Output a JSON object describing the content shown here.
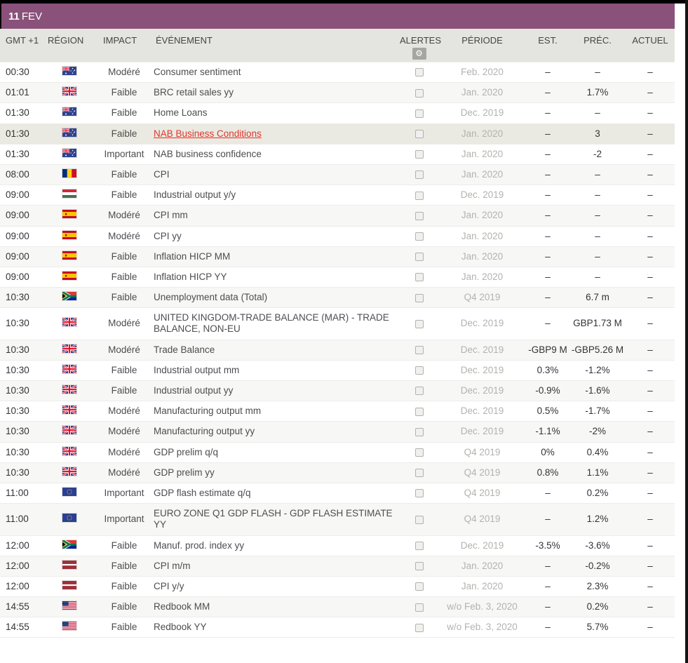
{
  "banner": {
    "day": "11",
    "month": "FEV"
  },
  "icons": {
    "gear_glyph": "⚙"
  },
  "colors": {
    "banner_bg": "#8a527a",
    "header_bg": "#e4e4e0",
    "row_alt_bg": "#f7f7f5",
    "highlight_row_bg": "#eaeae2",
    "link_red": "#e0352b",
    "period_text": "#b2b2b0"
  },
  "table": {
    "columns": [
      "GMT +1",
      "RÉGION",
      "IMPACT",
      "ÉVÉNEMENT",
      "ALERTES",
      "PÉRIODE",
      "EST.",
      "PRÉC.",
      "ACTUEL"
    ],
    "rows": [
      {
        "time": "00:30",
        "region": "AU",
        "impact": "Modéré",
        "event": "Consumer sentiment",
        "period": "Feb. 2020",
        "est": "–",
        "prev": "–",
        "actual": "–"
      },
      {
        "time": "01:01",
        "region": "GB",
        "impact": "Faible",
        "event": "BRC retail sales yy",
        "period": "Jan. 2020",
        "est": "–",
        "prev": "1.7%",
        "actual": "–"
      },
      {
        "time": "01:30",
        "region": "AU",
        "impact": "Faible",
        "event": "Home Loans",
        "period": "Dec. 2019",
        "est": "–",
        "prev": "–",
        "actual": "–"
      },
      {
        "time": "01:30",
        "region": "AU",
        "impact": "Faible",
        "event": "NAB Business Conditions",
        "period": "Jan. 2020",
        "est": "–",
        "prev": "3",
        "actual": "–",
        "link": true,
        "highlight": true
      },
      {
        "time": "01:30",
        "region": "AU",
        "impact": "Important",
        "event": "NAB business confidence",
        "period": "Jan. 2020",
        "est": "–",
        "prev": "-2",
        "actual": "–"
      },
      {
        "time": "08:00",
        "region": "RO",
        "impact": "Faible",
        "event": "CPI",
        "period": "Jan. 2020",
        "est": "–",
        "prev": "–",
        "actual": "–"
      },
      {
        "time": "09:00",
        "region": "HU",
        "impact": "Faible",
        "event": "Industrial output y/y",
        "period": "Dec. 2019",
        "est": "–",
        "prev": "–",
        "actual": "–"
      },
      {
        "time": "09:00",
        "region": "ES",
        "impact": "Modéré",
        "event": "CPI mm",
        "period": "Jan. 2020",
        "est": "–",
        "prev": "–",
        "actual": "–"
      },
      {
        "time": "09:00",
        "region": "ES",
        "impact": "Modéré",
        "event": "CPI yy",
        "period": "Jan. 2020",
        "est": "–",
        "prev": "–",
        "actual": "–"
      },
      {
        "time": "09:00",
        "region": "ES",
        "impact": "Faible",
        "event": "Inflation HICP MM",
        "period": "Jan. 2020",
        "est": "–",
        "prev": "–",
        "actual": "–"
      },
      {
        "time": "09:00",
        "region": "ES",
        "impact": "Faible",
        "event": "Inflation HICP YY",
        "period": "Jan. 2020",
        "est": "–",
        "prev": "–",
        "actual": "–"
      },
      {
        "time": "10:30",
        "region": "ZA",
        "impact": "Faible",
        "event": "Unemployment data (Total)",
        "period": "Q4 2019",
        "est": "–",
        "prev": "6.7 m",
        "actual": "–"
      },
      {
        "time": "10:30",
        "region": "GB",
        "impact": "Modéré",
        "event": "UNITED KINGDOM-TRADE BALANCE (MAR) - TRADE BALANCE, NON-EU",
        "period": "Dec. 2019",
        "est": "–",
        "prev": "GBP1.73 M",
        "actual": "–"
      },
      {
        "time": "10:30",
        "region": "GB",
        "impact": "Modéré",
        "event": "Trade Balance",
        "period": "Dec. 2019",
        "est": "-GBP9 M",
        "prev": "-GBP5.26 M",
        "actual": "–"
      },
      {
        "time": "10:30",
        "region": "GB",
        "impact": "Faible",
        "event": "Industrial output mm",
        "period": "Dec. 2019",
        "est": "0.3%",
        "prev": "-1.2%",
        "actual": "–"
      },
      {
        "time": "10:30",
        "region": "GB",
        "impact": "Faible",
        "event": "Industrial output yy",
        "period": "Dec. 2019",
        "est": "-0.9%",
        "prev": "-1.6%",
        "actual": "–"
      },
      {
        "time": "10:30",
        "region": "GB",
        "impact": "Modéré",
        "event": "Manufacturing output mm",
        "period": "Dec. 2019",
        "est": "0.5%",
        "prev": "-1.7%",
        "actual": "–"
      },
      {
        "time": "10:30",
        "region": "GB",
        "impact": "Modéré",
        "event": "Manufacturing output yy",
        "period": "Dec. 2019",
        "est": "-1.1%",
        "prev": "-2%",
        "actual": "–"
      },
      {
        "time": "10:30",
        "region": "GB",
        "impact": "Modéré",
        "event": "GDP prelim q/q",
        "period": "Q4 2019",
        "est": "0%",
        "prev": "0.4%",
        "actual": "–"
      },
      {
        "time": "10:30",
        "region": "GB",
        "impact": "Modéré",
        "event": "GDP prelim yy",
        "period": "Q4 2019",
        "est": "0.8%",
        "prev": "1.1%",
        "actual": "–"
      },
      {
        "time": "11:00",
        "region": "EU",
        "impact": "Important",
        "event": "GDP flash estimate q/q",
        "period": "Q4 2019",
        "est": "–",
        "prev": "0.2%",
        "actual": "–"
      },
      {
        "time": "11:00",
        "region": "EU",
        "impact": "Important",
        "event": "EURO ZONE Q1 GDP FLASH - GDP FLASH ESTIMATE YY",
        "period": "Q4 2019",
        "est": "–",
        "prev": "1.2%",
        "actual": "–"
      },
      {
        "time": "12:00",
        "region": "ZA",
        "impact": "Faible",
        "event": "Manuf. prod. index yy",
        "period": "Dec. 2019",
        "est": "-3.5%",
        "prev": "-3.6%",
        "actual": "–"
      },
      {
        "time": "12:00",
        "region": "LV",
        "impact": "Faible",
        "event": "CPI m/m",
        "period": "Jan. 2020",
        "est": "–",
        "prev": "-0.2%",
        "actual": "–"
      },
      {
        "time": "12:00",
        "region": "LV",
        "impact": "Faible",
        "event": "CPI y/y",
        "period": "Jan. 2020",
        "est": "–",
        "prev": "2.3%",
        "actual": "–"
      },
      {
        "time": "14:55",
        "region": "US",
        "impact": "Faible",
        "event": "Redbook MM",
        "period": "w/o Feb. 3, 2020",
        "est": "–",
        "prev": "0.2%",
        "actual": "–"
      },
      {
        "time": "14:55",
        "region": "US",
        "impact": "Faible",
        "event": "Redbook YY",
        "period": "w/o Feb. 3, 2020",
        "est": "–",
        "prev": "5.7%",
        "actual": "–"
      }
    ]
  }
}
